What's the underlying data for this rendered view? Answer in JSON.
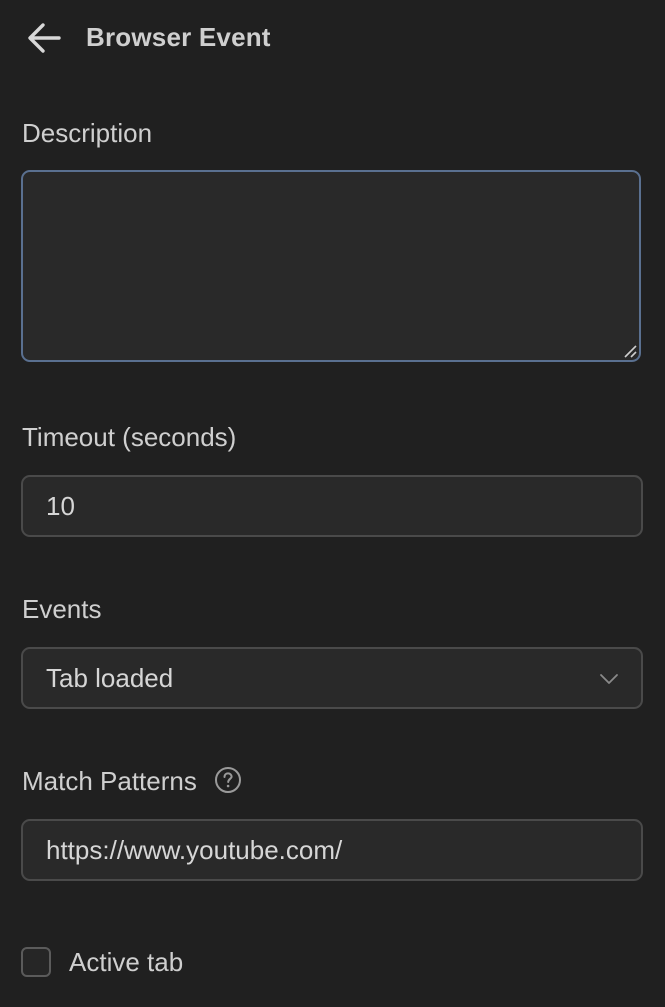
{
  "header": {
    "back_icon": "arrow-left-icon",
    "title": "Browser Event"
  },
  "form": {
    "description": {
      "label": "Description",
      "value": ""
    },
    "timeout": {
      "label": "Timeout (seconds)",
      "value": "10"
    },
    "events": {
      "label": "Events",
      "selected": "Tab loaded",
      "icon": "chevron-down-icon"
    },
    "match_patterns": {
      "label": "Match Patterns",
      "help_icon": "help-circle-icon",
      "value": "https://www.youtube.com/"
    },
    "active_tab": {
      "label": "Active tab",
      "checked": false
    }
  },
  "colors": {
    "background": "#202020",
    "input_background": "#292929",
    "focus_border": "#5a7090",
    "border": "#4a4a4a",
    "text": "#d6d6d6"
  }
}
